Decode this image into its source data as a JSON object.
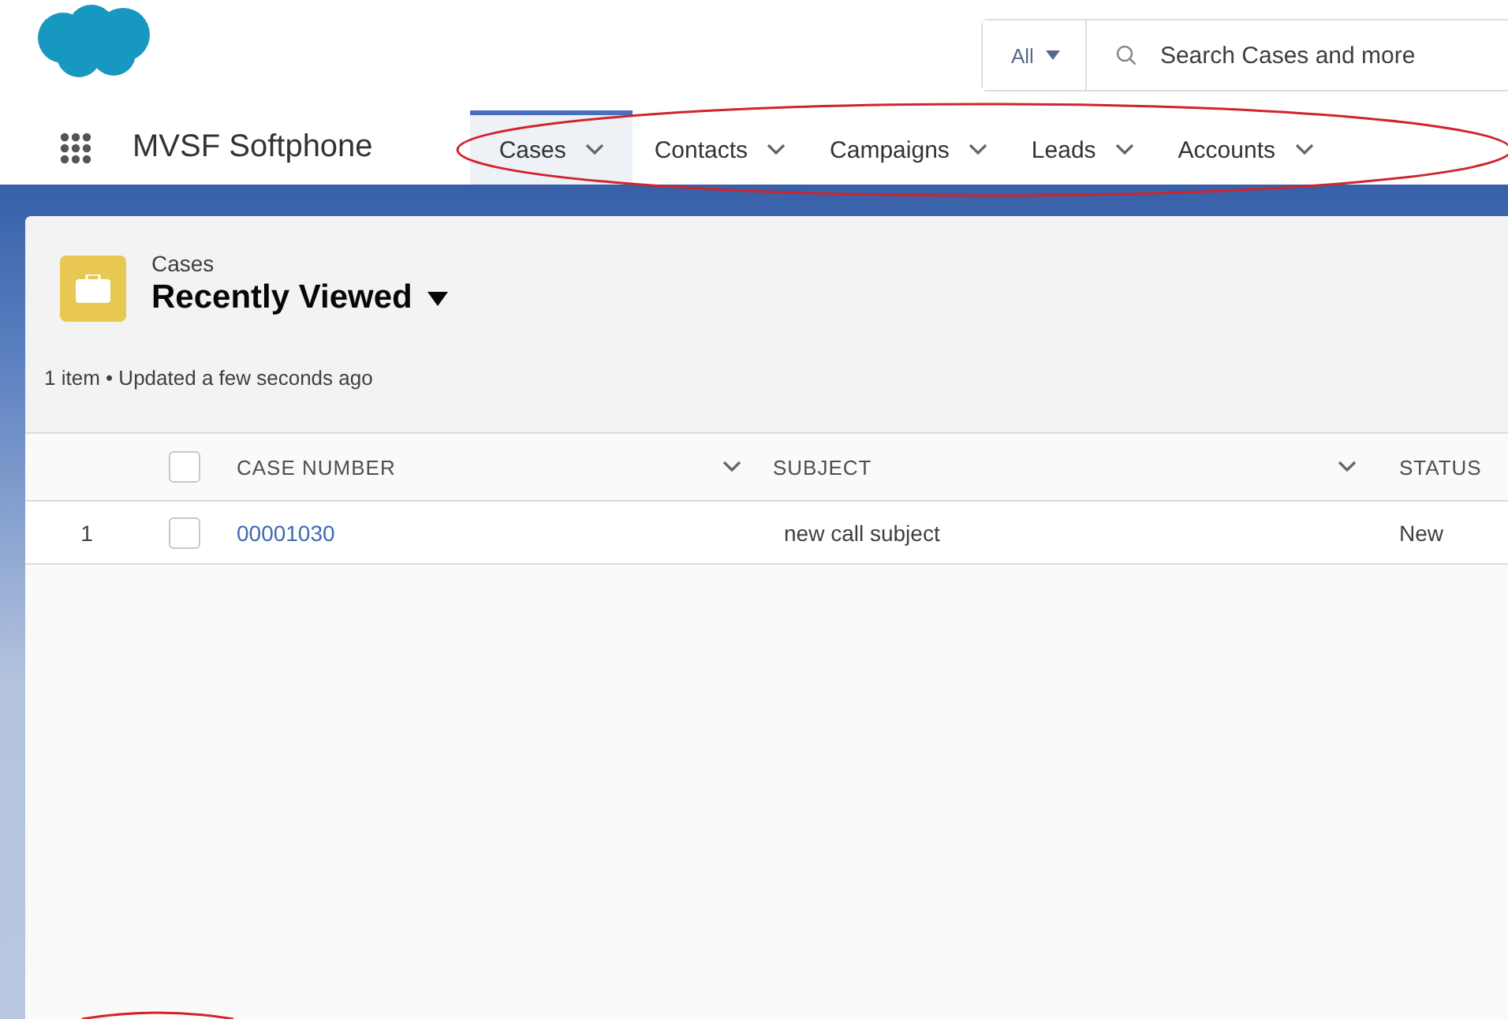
{
  "app": {
    "name": "MVSF Softphone"
  },
  "search": {
    "scope": "All",
    "placeholder": "Search Cases and more"
  },
  "tabs": [
    {
      "label": "Cases",
      "selected": true
    },
    {
      "label": "Contacts",
      "selected": false
    },
    {
      "label": "Campaigns",
      "selected": false
    },
    {
      "label": "Leads",
      "selected": false
    },
    {
      "label": "Accounts",
      "selected": false
    }
  ],
  "list_view": {
    "object": "Cases",
    "title": "Recently Viewed",
    "meta": "1 item • Updated a few seconds ago"
  },
  "table": {
    "select_all_checked": false,
    "columns": [
      {
        "label": "CASE NUMBER"
      },
      {
        "label": "SUBJECT"
      },
      {
        "label": "STATUS"
      }
    ],
    "rows": [
      {
        "number": "1",
        "checked": false,
        "case_number": "00001030",
        "subject": "new call subject",
        "status": "New"
      }
    ]
  }
}
